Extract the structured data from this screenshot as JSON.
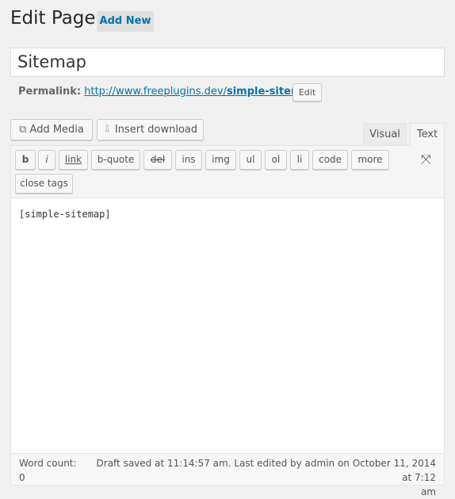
{
  "header": {
    "title": "Edit Page",
    "add_new": "Add New"
  },
  "post_title": "Sitemap",
  "permalink": {
    "label": "Permalink:",
    "url_base": "http://www.freeplugins.dev/",
    "slug": "simple-sitemap",
    "url_end": "/",
    "edit": "Edit"
  },
  "media": {
    "add_media": "Add Media",
    "insert_download": "Insert download"
  },
  "tabs": {
    "visual": "Visual",
    "text": "Text"
  },
  "quicktags": [
    "b",
    "i",
    "link",
    "b-quote",
    "del",
    "ins",
    "img",
    "ul",
    "ol",
    "li",
    "code",
    "more",
    "close tags"
  ],
  "content": "[simple-sitemap]",
  "footer": {
    "word_count_label": "Word count:",
    "word_count": "0",
    "status_line1": "Draft saved at 11:14:57 am. Last edited by admin on October 11, 2014 at 7:12",
    "status_line2": "am"
  }
}
